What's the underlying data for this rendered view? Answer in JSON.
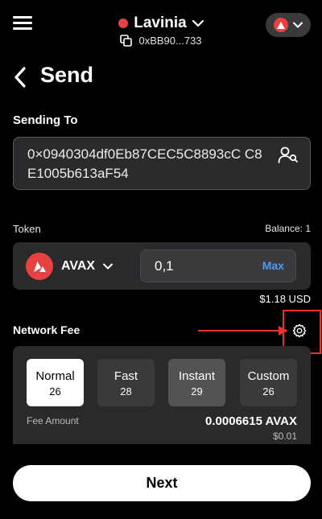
{
  "header": {
    "account_name": "Lavinia",
    "account_status_color": "#e84142",
    "address_short": "0xBB90...733",
    "menu_icon": "hamburger-menu-icon",
    "network_icon": "avalanche-icon"
  },
  "page": {
    "title": "Send"
  },
  "sending_to": {
    "label": "Sending To",
    "address": "0×0940304df0Eb87CEC5C8893cC C8E1005b613aF54"
  },
  "token": {
    "label": "Token",
    "balance": "Balance: 1",
    "symbol": "AVAX",
    "amount": "0,1",
    "max_label": "Max",
    "usd_value": "$1.18 USD"
  },
  "network_fee": {
    "label": "Network Fee",
    "options": [
      {
        "name": "Normal",
        "value": "26"
      },
      {
        "name": "Fast",
        "value": "28"
      },
      {
        "name": "Instant",
        "value": "29"
      },
      {
        "name": "Custom",
        "value": "26"
      }
    ],
    "selected": "Normal",
    "fee_amount_label": "Fee Amount",
    "fee_amount": "0.0006615 AVAX",
    "fee_usd": "$0.01"
  },
  "actions": {
    "next_label": "Next"
  },
  "colors": {
    "background": "#000000",
    "panel": "#2a2a2c",
    "accent_red": "#e84142",
    "link_blue": "#4b9cf5",
    "annotation_red": "#e8332a"
  }
}
